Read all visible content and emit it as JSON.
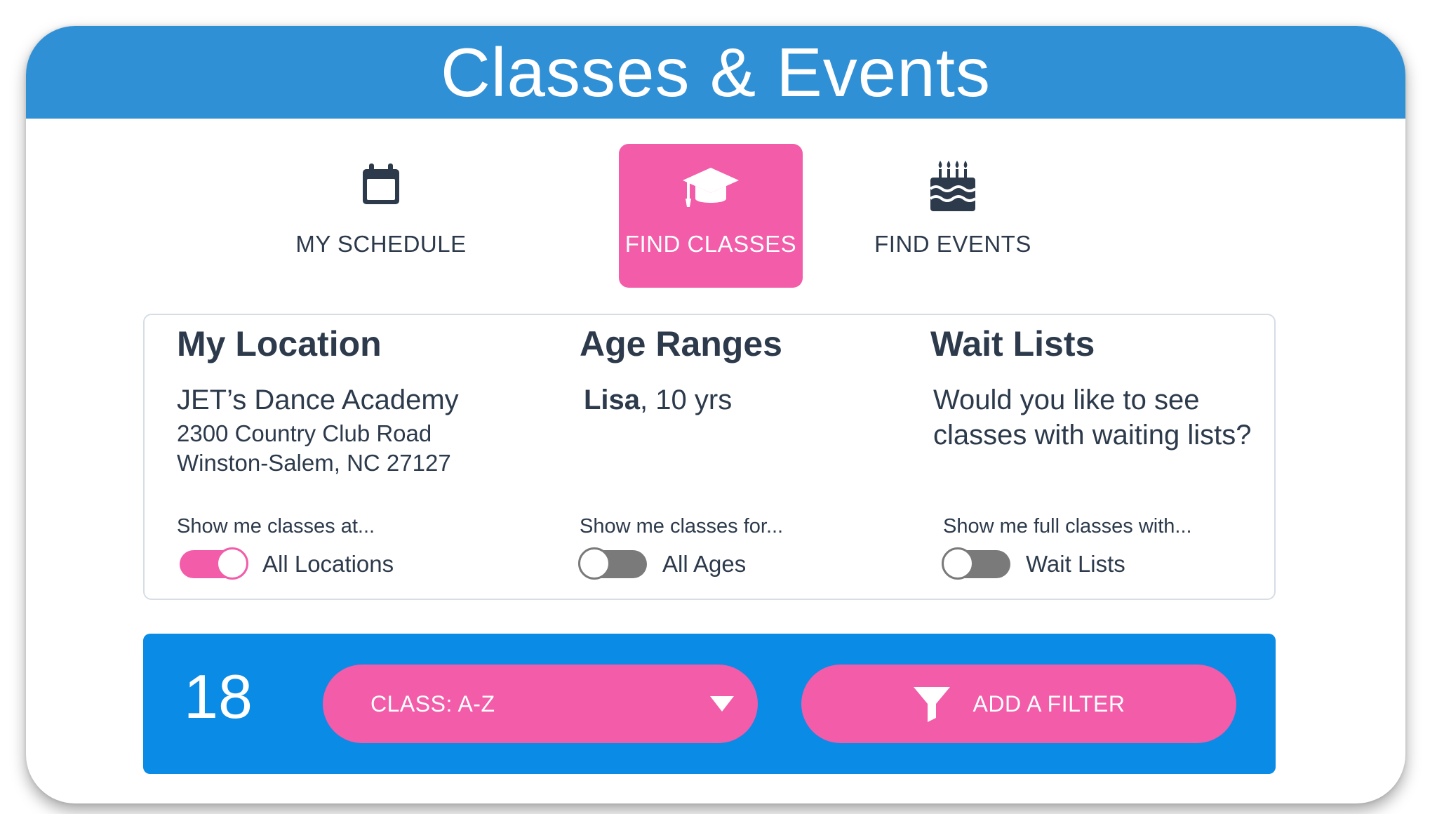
{
  "header": {
    "title": "Classes & Events"
  },
  "tabs": [
    {
      "label": "MY SCHEDULE",
      "icon": "calendar-icon",
      "active": false
    },
    {
      "label": "FIND CLASSES",
      "icon": "graduation-cap-icon",
      "active": true
    },
    {
      "label": "FIND EVENTS",
      "icon": "birthday-cake-icon",
      "active": false
    }
  ],
  "location": {
    "title": "My Location",
    "studio": "JET’s Dance Academy",
    "address_line1": "2300 Country Club Road",
    "address_line2": "Winston-Salem, NC 27127",
    "caption": "Show me classes at...",
    "toggle_label": "All Locations",
    "toggle_on": true
  },
  "ages": {
    "title": "Age Ranges",
    "student_name": "Lisa",
    "student_age": ", 10 yrs",
    "caption": "Show me classes for...",
    "toggle_label": "All Ages",
    "toggle_on": false
  },
  "waitlists": {
    "title": "Wait Lists",
    "question_line1": "Would you like to see",
    "question_line2": "classes with waiting lists?",
    "caption": "Show me full classes with...",
    "toggle_label": "Wait Lists",
    "toggle_on": false
  },
  "action_bar": {
    "count": "18",
    "sort_label": "CLASS: A-Z",
    "filter_label": "ADD A FILTER"
  },
  "colors": {
    "header_blue": "#3090d6",
    "action_blue": "#098be6",
    "accent_pink": "#f25ca9",
    "toggle_off": "#7a7a7a",
    "text_dark": "#2c3a4b"
  }
}
